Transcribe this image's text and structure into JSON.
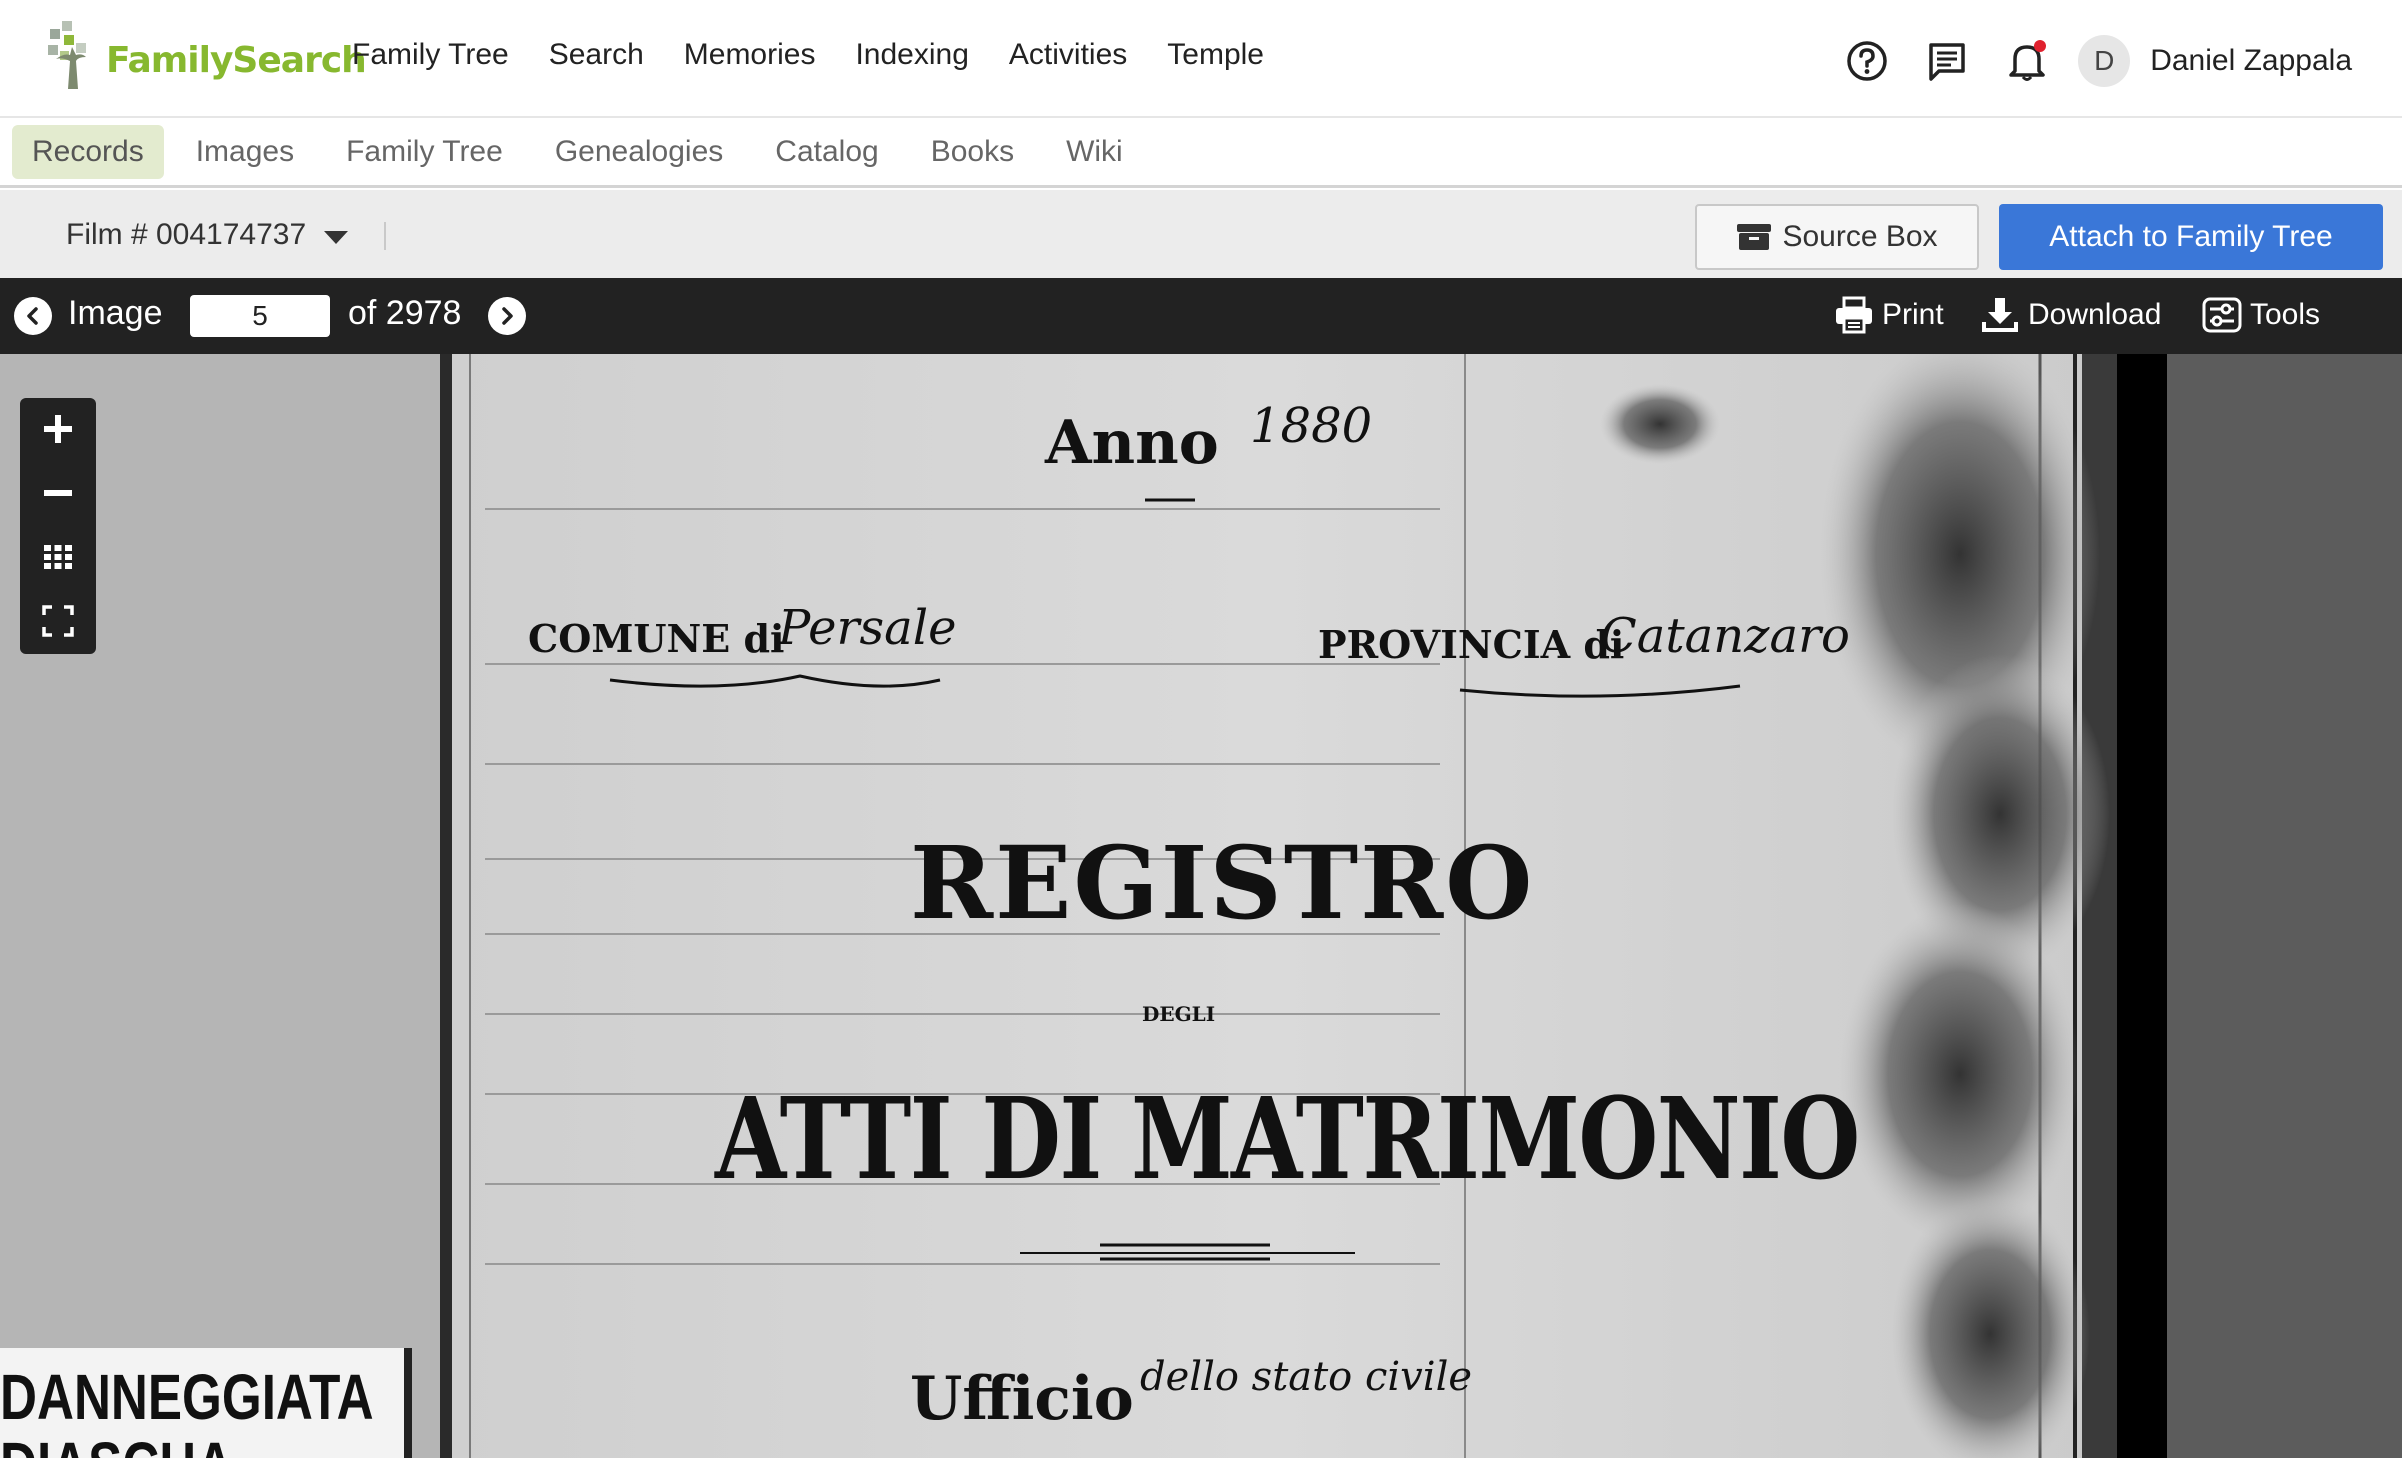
{
  "header": {
    "logo_text": "FamilySearch",
    "nav": [
      "Family Tree",
      "Search",
      "Memories",
      "Indexing",
      "Activities",
      "Temple"
    ],
    "user": {
      "initial": "D",
      "name": "Daniel Zappala"
    }
  },
  "subnav": {
    "items": [
      "Records",
      "Images",
      "Family Tree",
      "Genealogies",
      "Catalog",
      "Books",
      "Wiki"
    ],
    "active": "Records"
  },
  "filmbar": {
    "film_label": "Film # 004174737",
    "source_box_label": "Source Box",
    "attach_label": "Attach to Family Tree"
  },
  "image_toolbar": {
    "image_label": "Image",
    "current_image": "5",
    "total_label": "of 2978",
    "print_label": "Print",
    "download_label": "Download",
    "tools_label": "Tools"
  },
  "document": {
    "anno_label": "Anno",
    "anno_year": "1880",
    "comune_label": "COMUNE di",
    "comune_value": "Persale",
    "provincia_label": "PROVINCIA di",
    "provincia_value": "Catanzaro",
    "title_registro": "REGISTRO",
    "title_degli": "DEGLI",
    "title_atti": "ATTI DI MATRIMONIO",
    "ufficio_label": "Ufficio",
    "ufficio_value": "dello stato civile",
    "stamp_line1": "DANNEGGIATA",
    "stamp_line2": "DIASCHA"
  },
  "colors": {
    "brand_green": "#87b82f",
    "primary_blue": "#3a77d8",
    "toolbar_dark": "#222222",
    "active_tab_bg": "#e3ebcf",
    "notification_red": "#e0212e"
  }
}
